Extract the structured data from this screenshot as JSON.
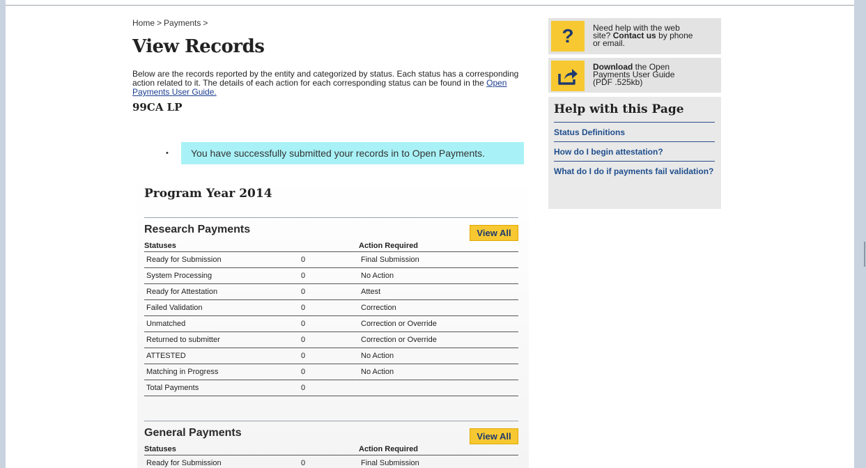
{
  "breadcrumb": {
    "home": "Home",
    "sep1": ">",
    "current": "Payments",
    "sep2": ">"
  },
  "page": {
    "title": "View Records",
    "intro_text": "Below are the records reported by the entity and categorized by status. Each status has a corresponding action related to it. The details of each action for each corresponding status can be found in the",
    "intro_link": "Open Payments User Guide.",
    "entity": "99CA LP",
    "bullet": "•",
    "notice": "You have successfully submitted your records in to Open Payments."
  },
  "program": {
    "year_label": "Program Year 2014",
    "research": {
      "title": "Research Payments",
      "view_all": "View All",
      "headers": [
        "Statuses",
        "",
        "Action Required"
      ],
      "rows": [
        [
          "Ready for Submission",
          "0",
          "Final Submission"
        ],
        [
          "System Processing",
          "0",
          "No Action"
        ],
        [
          "Ready for Attestation",
          "0",
          "Attest"
        ],
        [
          "Failed Validation",
          "0",
          "Correction"
        ],
        [
          "Unmatched",
          "0",
          "Correction or Override"
        ],
        [
          "Returned to submitter",
          "0",
          "Correction or Override"
        ],
        [
          "ATTESTED",
          "0",
          "No Action"
        ],
        [
          "Matching in Progress",
          "0",
          "No Action"
        ],
        [
          "Total Payments",
          "0",
          ""
        ]
      ]
    },
    "general": {
      "title": "General Payments",
      "view_all": "View All",
      "headers": [
        "Statuses",
        "",
        "Action Required"
      ],
      "rows": [
        [
          "Ready for Submission",
          "0",
          "Final Submission"
        ]
      ]
    }
  },
  "sidebar": {
    "help": {
      "icon": "?",
      "line1": "Need help with the web",
      "line2_pre": "site?",
      "line2_bold": "Contact us",
      "line2_post": "by phone",
      "line3": "or email."
    },
    "download": {
      "bold": "Download",
      "line1_post": "the Open",
      "line2": "Payments User Guide",
      "line3": "(PDF .525kb)"
    },
    "help_page": {
      "title": "Help with this Page",
      "links": [
        "Status Definitions",
        "How do I begin attestation?",
        "What do I do if payments fail validation?"
      ]
    }
  },
  "colors": {
    "accent_yellow": "#f7c831",
    "notice_bg": "#a8f2f7",
    "link_blue": "#1f4e8c"
  }
}
